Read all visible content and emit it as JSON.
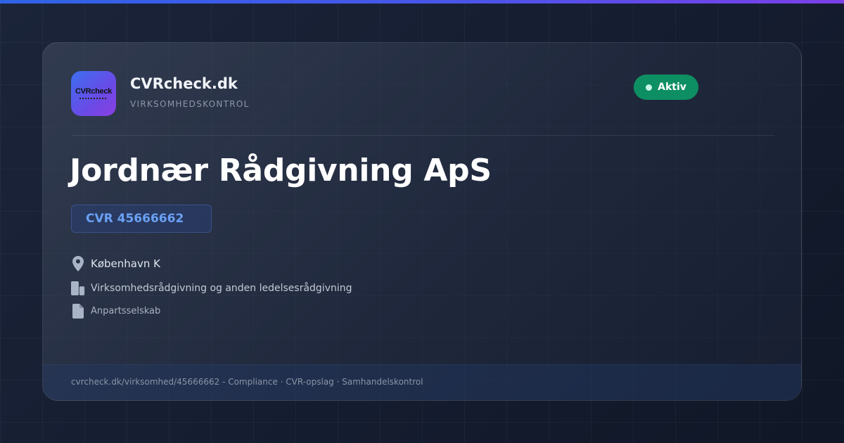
{
  "brand": {
    "name": "CVRcheck.dk",
    "tagline": "VIRKSOMHEDSKONTROL",
    "logo_text": "CVRcheck"
  },
  "status": {
    "label": "Aktiv",
    "color": "#0e8f63"
  },
  "company": {
    "name": "Jordnær Rådgivning ApS",
    "cvr": "CVR 45666662",
    "location": "København K",
    "industry": "Virksomhedsrådgivning og anden ledelsesrådgivning",
    "legal_form": "Anpartsselskab"
  },
  "icons": {
    "location": "map-pin-icon",
    "industry": "building-icon",
    "legal_form": "document-icon"
  },
  "footer": {
    "text": "cvrcheck.dk/virksomhed/45666662 - Compliance · CVR-opslag · Samhandelskontrol"
  },
  "colors": {
    "accent": "#6aa1f5",
    "brand_gradient_start": "#2f63e6",
    "brand_gradient_end": "#7b3fe6",
    "background": "#131b2e"
  }
}
